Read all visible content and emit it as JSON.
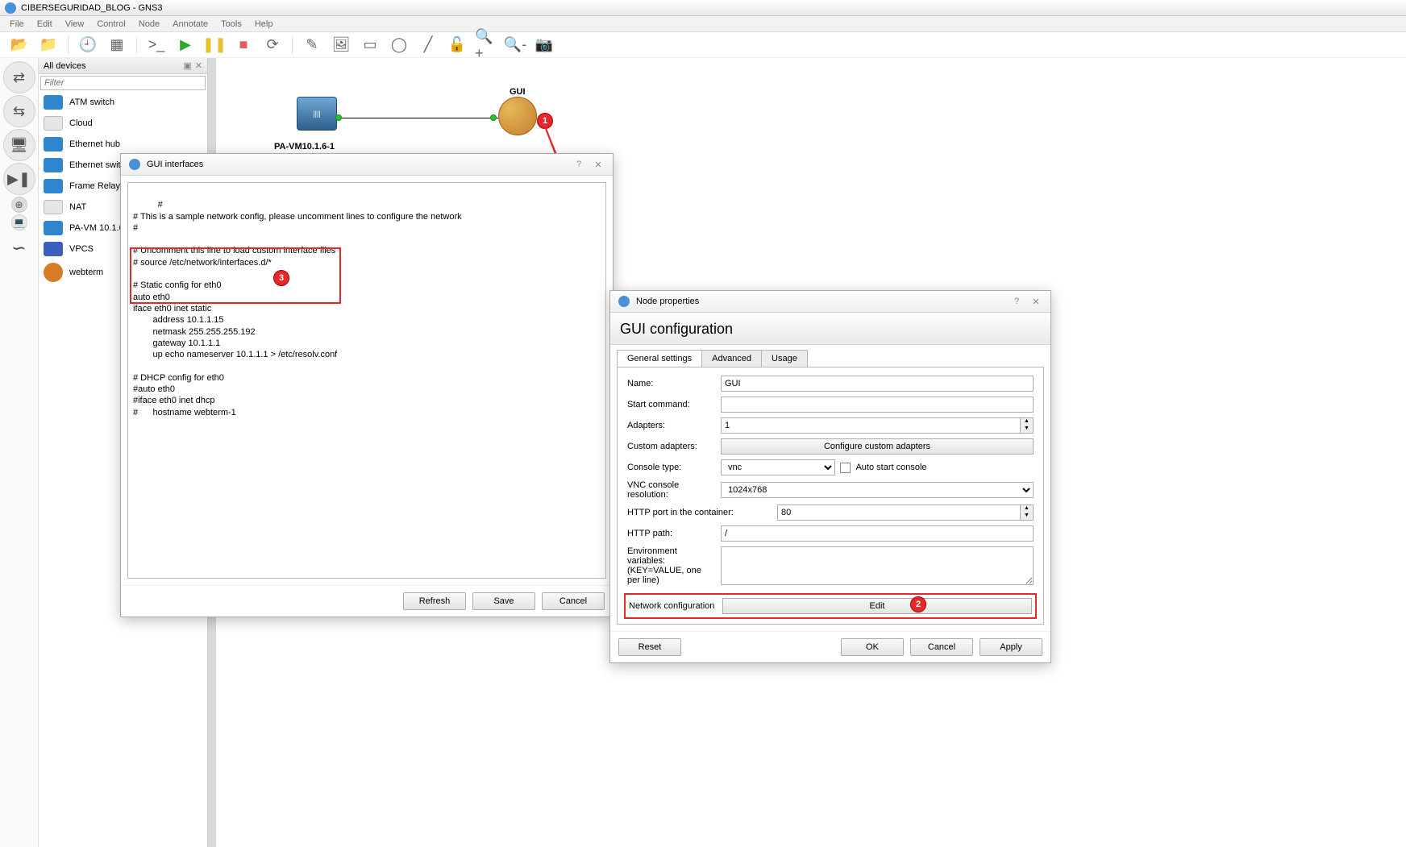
{
  "window_title": "CIBERSEGURIDAD_BLOG - GNS3",
  "menus": [
    "File",
    "Edit",
    "View",
    "Control",
    "Node",
    "Annotate",
    "Tools",
    "Help"
  ],
  "device_panel": {
    "title": "All devices",
    "filter_placeholder": "Filter",
    "items": [
      {
        "label": "ATM switch",
        "color": "#2f86cf"
      },
      {
        "label": "Cloud",
        "color": "#e6e6e6"
      },
      {
        "label": "Ethernet hub",
        "color": "#2f86cf"
      },
      {
        "label": "Ethernet switch",
        "color": "#2f86cf"
      },
      {
        "label": "Frame Relay switch",
        "color": "#2f86cf"
      },
      {
        "label": "NAT",
        "color": "#e6e6e6"
      },
      {
        "label": "PA-VM 10.1.6",
        "color": "#2f86cf"
      },
      {
        "label": "VPCS",
        "color": "#3a5fbf"
      },
      {
        "label": "webterm",
        "color": "#d97a26"
      }
    ]
  },
  "topology": {
    "gui_label": "GUI",
    "pavm_label": "PA-VM10.1.6-1",
    "anno1": "1",
    "anno2": "2",
    "anno3": "3"
  },
  "interfaces_dialog": {
    "title": "GUI interfaces",
    "content": "#\n# This is a sample network config, please uncomment lines to configure the network\n#\n\n# Uncomment this line to load custom interface files\n# source /etc/network/interfaces.d/*\n\n# Static config for eth0\nauto eth0\niface eth0 inet static\n\taddress 10.1.1.15\n\tnetmask 255.255.255.192\n\tgateway 10.1.1.1\n\tup echo nameserver 10.1.1.1 > /etc/resolv.conf\n\n# DHCP config for eth0\n#auto eth0\n#iface eth0 inet dhcp\n#\thostname webterm-1",
    "btn_refresh": "Refresh",
    "btn_save": "Save",
    "btn_cancel": "Cancel"
  },
  "props_dialog": {
    "title": "Node properties",
    "header": "GUI configuration",
    "tabs": [
      "General settings",
      "Advanced",
      "Usage"
    ],
    "labels": {
      "name": "Name:",
      "start_cmd": "Start command:",
      "adapters": "Adapters:",
      "custom_adapters": "Custom adapters:",
      "console_type": "Console type:",
      "auto_start": "Auto start console",
      "vnc_res": "VNC console resolution:",
      "http_port": "HTTP port in the container:",
      "http_path": "HTTP path:",
      "env": "Environment variables:",
      "env2": "(KEY=VALUE, one per line)",
      "net_conf": "Network configuration"
    },
    "values": {
      "name": "GUI",
      "start_cmd": "",
      "adapters": "1",
      "custom_btn": "Configure custom adapters",
      "console_type": "vnc",
      "vnc_res": "1024x768",
      "http_port": "80",
      "http_path": "/",
      "edit_btn": "Edit"
    },
    "btn_reset": "Reset",
    "btn_ok": "OK",
    "btn_cancel": "Cancel",
    "btn_apply": "Apply"
  }
}
